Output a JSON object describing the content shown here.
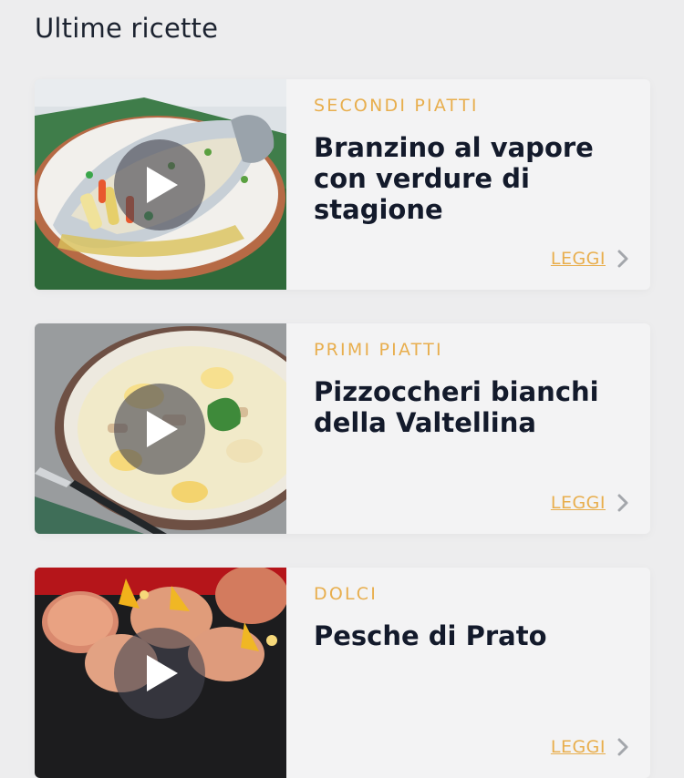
{
  "header": {
    "title": "Ultime ricette"
  },
  "recipes": [
    {
      "category": "SECONDI PIATTI",
      "title": "Branzino al vapore con verdure di stagione",
      "read_label": "LEGGI",
      "image_icon": "steamed-sea-bass-photo"
    },
    {
      "category": "PRIMI PIATTI",
      "title": "Pizzoccheri bianchi della Valtellina",
      "read_label": "LEGGI",
      "image_icon": "pizzoccheri-photo"
    },
    {
      "category": "DOLCI",
      "title": "Pesche di Prato",
      "read_label": "LEGGI",
      "image_icon": "peach-pastries-photo"
    }
  ],
  "colors": {
    "accent": "#e8ae4d",
    "title": "#131a2b",
    "background": "#ededee",
    "card": "#f3f3f4"
  }
}
